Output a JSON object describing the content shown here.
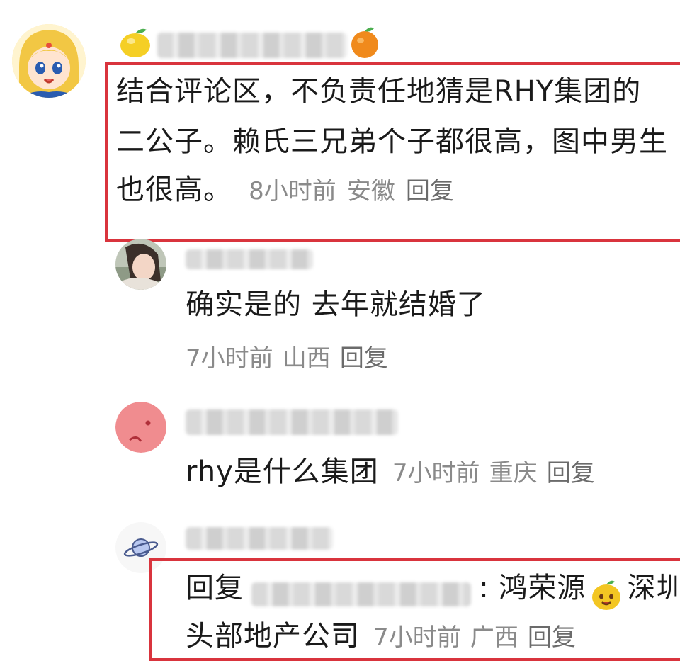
{
  "comments": [
    {
      "lines": [
        "结合评论区，不负责任地猜是RHY集团的",
        "二公子。赖氏三兄弟个子都很高，图中男生",
        "也很高。"
      ],
      "time": "8小时前",
      "location": "安徽",
      "reply_label": "回复"
    },
    {
      "text": "确实是的 去年就结婚了",
      "time": "7小时前",
      "location": "山西",
      "reply_label": "回复"
    },
    {
      "text": "rhy是什么集团",
      "time": "7小时前",
      "location": "重庆",
      "reply_label": "回复"
    },
    {
      "prefix": "回复",
      "after_name": ": 鸿荣源",
      "after_emoji": "深圳",
      "line2": "头部地产公司",
      "time": "7小时前",
      "location": "广西",
      "reply_label": "回复"
    }
  ],
  "icons": {
    "badge_left": "lemon-icon",
    "badge_right": "orange-icon",
    "emoji": "smiling-fruit-emoji",
    "avatar4": "planet-icon"
  },
  "colors": {
    "highlight": "#d9343d",
    "meta": "#8a8a8a"
  }
}
